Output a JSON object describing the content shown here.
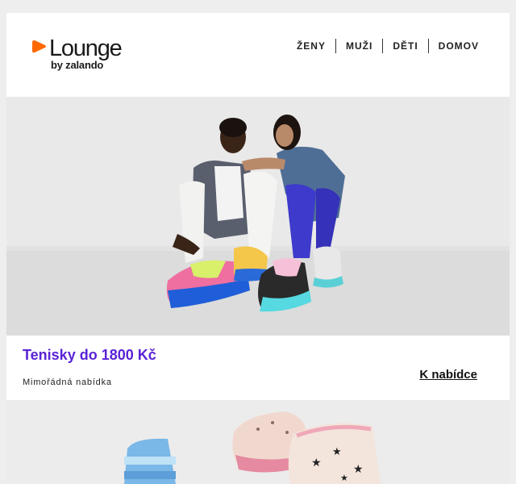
{
  "brand": {
    "name": "Lounge",
    "sub": "by zalando",
    "accent": "#ff6900"
  },
  "nav": {
    "items": [
      "ŽENY",
      "MUŽI",
      "DĚTI",
      "DOMOV"
    ]
  },
  "hero": {
    "image": "two-models-sitting-in-sneakers"
  },
  "offer": {
    "title": "Tenisky do 1800 Kč",
    "subtitle": "Mimořádná nabídka",
    "cta": "K nabídce",
    "title_color": "#5a23d6"
  },
  "second": {
    "image": "padded-boots-and-sneakers"
  }
}
